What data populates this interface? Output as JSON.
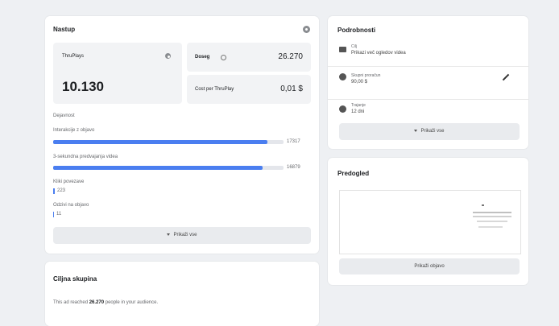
{
  "performance": {
    "title": "Nastup",
    "thruplays_label": "ThruPlays",
    "thruplays_value": "10.130",
    "reach_label": "Doseg",
    "reach_value": "26.270",
    "cost_label": "Cost per ThruPlay",
    "cost_value": "0,01 $",
    "engagement_label": "Dejavnost",
    "metrics": [
      {
        "label": "Interakcije z objavo",
        "value": "17317",
        "fraction": 0.93
      },
      {
        "label": "3-sekundna predvajanja videa",
        "value": "16879",
        "fraction": 0.91
      },
      {
        "label": "Kliki povezave",
        "value": "223",
        "fraction": 0.012
      },
      {
        "label": "Odzivi na objavo",
        "value": "11",
        "fraction": 0.004
      }
    ],
    "show_more": "Prikaži vse"
  },
  "audience": {
    "title": "Ciljna skupina",
    "text_prefix": "This ad reached",
    "text_value": "26.270",
    "text_suffix": "people in your audience."
  },
  "details": {
    "title": "Podrobnosti",
    "items": [
      {
        "icon": "video-icon",
        "label": "Cilj",
        "value": "Prikazi več ogledov videa"
      },
      {
        "icon": "budget-icon",
        "label": "Skupni proračun",
        "value": "90,00 $"
      },
      {
        "icon": "clock-icon",
        "label": "Trajanje",
        "value": "12 dni"
      }
    ],
    "show_more": "Prikaži vse"
  },
  "preview": {
    "title": "Predogled",
    "button": "Prikaži objavo"
  }
}
